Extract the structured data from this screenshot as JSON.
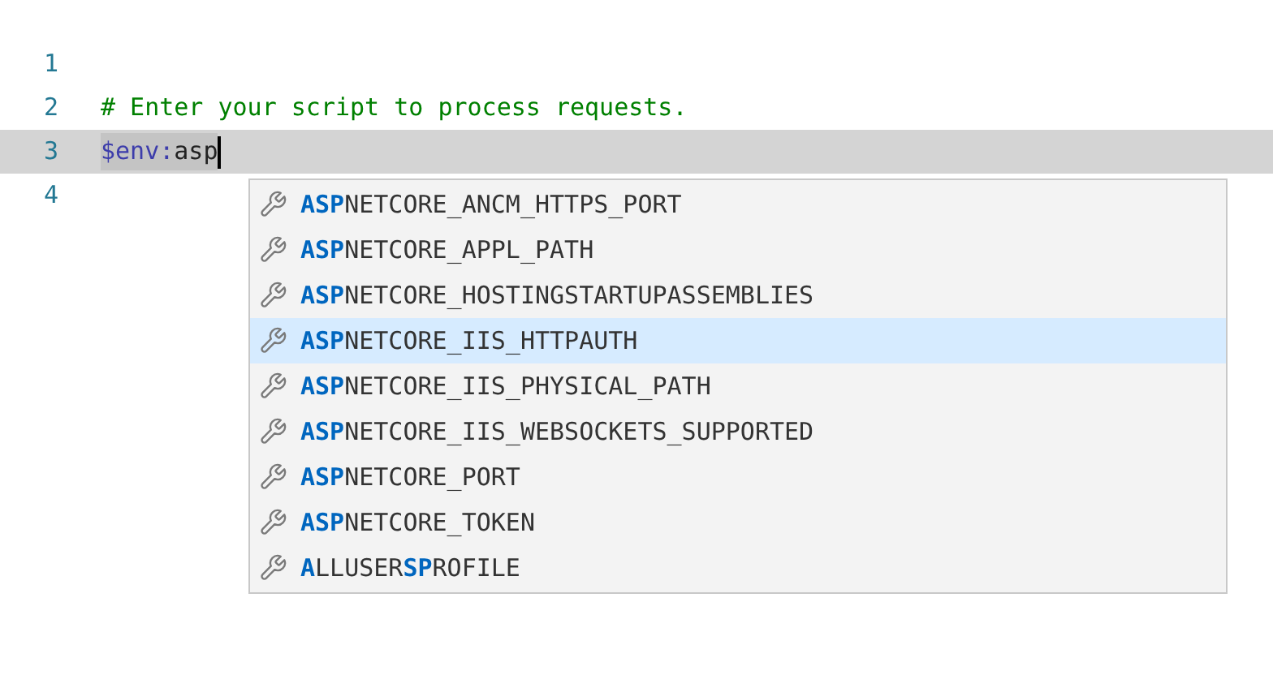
{
  "editor": {
    "lines": [
      {
        "number": "1",
        "current": false
      },
      {
        "number": "2",
        "tokens": [
          {
            "kind": "comment",
            "text": "# Enter your script to process requests."
          }
        ],
        "current": false
      },
      {
        "number": "3",
        "tokens": [
          {
            "kind": "variable",
            "text": "$env:"
          },
          {
            "kind": "plain",
            "text": "asp"
          }
        ],
        "current": true
      },
      {
        "number": "4",
        "current": false
      }
    ]
  },
  "suggestions": [
    {
      "selected": false,
      "parts": [
        {
          "text": "ASP",
          "match": true
        },
        {
          "text": "NETCORE_ANCM_HTTPS_PORT",
          "match": false
        }
      ]
    },
    {
      "selected": false,
      "parts": [
        {
          "text": "ASP",
          "match": true
        },
        {
          "text": "NETCORE_APPL_PATH",
          "match": false
        }
      ]
    },
    {
      "selected": false,
      "parts": [
        {
          "text": "ASP",
          "match": true
        },
        {
          "text": "NETCORE_HOSTINGSTARTUPASSEMBLIES",
          "match": false
        }
      ]
    },
    {
      "selected": true,
      "parts": [
        {
          "text": "ASP",
          "match": true
        },
        {
          "text": "NETCORE_IIS_HTTPAUTH",
          "match": false
        }
      ]
    },
    {
      "selected": false,
      "parts": [
        {
          "text": "ASP",
          "match": true
        },
        {
          "text": "NETCORE_IIS_PHYSICAL_PATH",
          "match": false
        }
      ]
    },
    {
      "selected": false,
      "parts": [
        {
          "text": "ASP",
          "match": true
        },
        {
          "text": "NETCORE_IIS_WEBSOCKETS_SUPPORTED",
          "match": false
        }
      ]
    },
    {
      "selected": false,
      "parts": [
        {
          "text": "ASP",
          "match": true
        },
        {
          "text": "NETCORE_PORT",
          "match": false
        }
      ]
    },
    {
      "selected": false,
      "parts": [
        {
          "text": "ASP",
          "match": true
        },
        {
          "text": "NETCORE_TOKEN",
          "match": false
        }
      ]
    },
    {
      "selected": false,
      "parts": [
        {
          "text": "A",
          "match": true
        },
        {
          "text": "LLUSER",
          "match": false
        },
        {
          "text": "SP",
          "match": true
        },
        {
          "text": "ROFILE",
          "match": false
        }
      ]
    }
  ]
}
